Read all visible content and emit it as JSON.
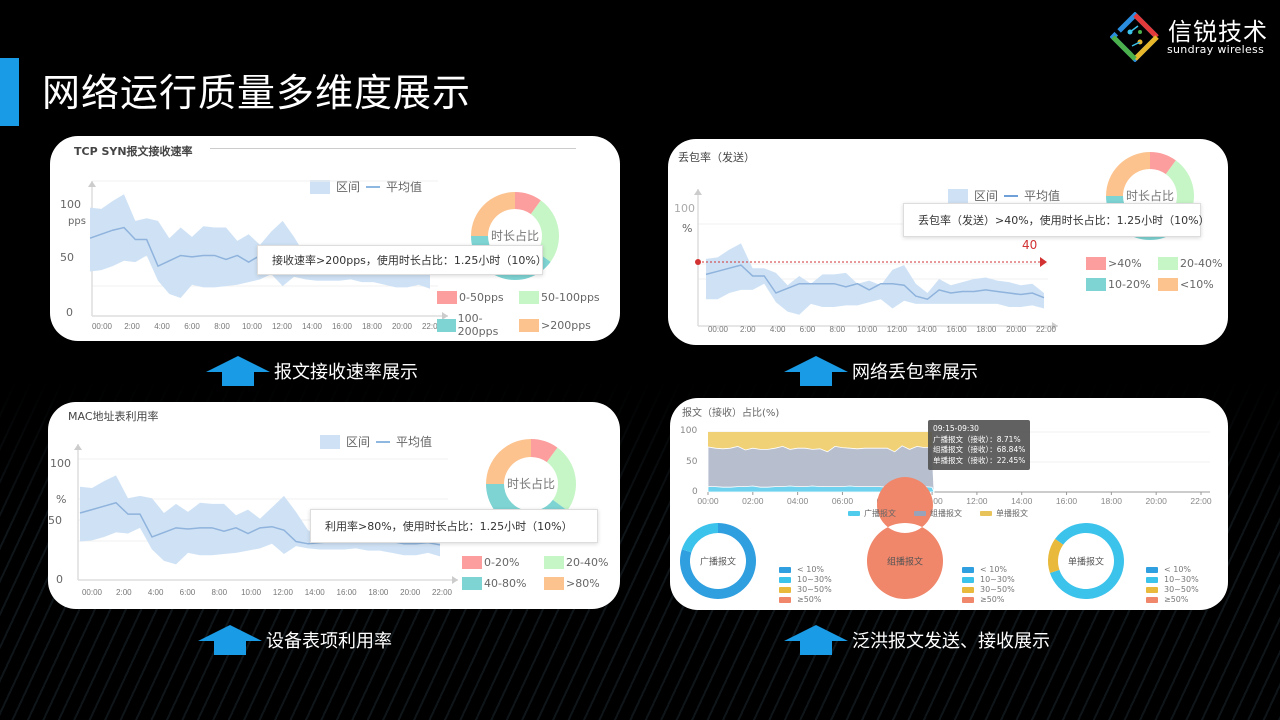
{
  "slide": {
    "title": "网络运行质量多维度展示",
    "accent_color": "#1a9be6"
  },
  "logo": {
    "name_cn": "信锐技术",
    "name_en": "sundray wireless"
  },
  "captions": [
    {
      "label": "报文接收速率展示",
      "icon": "arrow-up-icon"
    },
    {
      "label": "网络丢包率展示",
      "icon": "arrow-up-icon"
    },
    {
      "label": "设备表项利用率",
      "icon": "arrow-up-icon"
    },
    {
      "label": "泛洪报文发送、接收展示",
      "icon": "arrow-up-icon"
    }
  ],
  "chart_data": [
    {
      "type": "area",
      "title": "TCP SYN报文接收速率",
      "legend": [
        "区间",
        "平均值"
      ],
      "ylabel": "pps",
      "yticks": [
        "100",
        "50",
        "0"
      ],
      "ylim": [
        0,
        100
      ],
      "xticks": [
        "00:00",
        "2:00",
        "4:00",
        "6:00",
        "8:00",
        "10:00",
        "12:00",
        "14:00",
        "16:00",
        "18:00",
        "20:00",
        "22:00"
      ],
      "avg": [
        57,
        60,
        63,
        65,
        56,
        56,
        36,
        40,
        44,
        43,
        44,
        44,
        41,
        44,
        39,
        44,
        45,
        43,
        38,
        32,
        31,
        32,
        32,
        33,
        32,
        33,
        32,
        30,
        30,
        31,
        30
      ],
      "upper": [
        80,
        79,
        85,
        90,
        70,
        72,
        70,
        57,
        65,
        58,
        66,
        65,
        65,
        55,
        60,
        52,
        62,
        70,
        58,
        44,
        40,
        38,
        40,
        37,
        38,
        38,
        37,
        35,
        35,
        37,
        35
      ],
      "lower": [
        32,
        33,
        36,
        40,
        39,
        44,
        25,
        15,
        12,
        22,
        20,
        20,
        21,
        22,
        24,
        26,
        30,
        21,
        28,
        26,
        25,
        25,
        25,
        26,
        24,
        24,
        22,
        20,
        20,
        22,
        19
      ],
      "tooltip": "接收速率>200pps，使用时长占比：1.25小时（10%）",
      "donut": {
        "center_label": "时长占比",
        "slices": [
          {
            "label": "0-50pps",
            "value": 10,
            "color": "#fc9e9e"
          },
          {
            "label": "50-100pps",
            "value": 25,
            "color": "#c6f5c6"
          },
          {
            "label": "100-200pps",
            "value": 40,
            "color": "#7ed3d3"
          },
          {
            "label": ">200pps",
            "value": 25,
            "color": "#fcc38f"
          }
        ]
      }
    },
    {
      "type": "area",
      "title": "丢包率（发送）",
      "legend": [
        "区间",
        "平均值"
      ],
      "ylabel": "%",
      "yticks": [
        "100"
      ],
      "ylim": [
        0,
        100
      ],
      "threshold": {
        "value": 40,
        "label": "40",
        "color": "#d23232"
      },
      "xticks": [
        "00:00",
        "2:00",
        "4:00",
        "6:00",
        "8:00",
        "10:00",
        "12:00",
        "14:00",
        "16:00",
        "18:00",
        "20:00",
        "22:00"
      ],
      "avg": [
        32,
        34,
        36,
        38,
        31,
        31,
        20,
        23,
        26,
        26,
        26,
        26,
        24,
        26,
        22,
        26,
        26,
        25,
        18,
        16,
        22,
        20,
        21,
        21,
        22,
        21,
        20,
        19,
        20,
        17
      ],
      "upper": [
        42,
        43,
        48,
        52,
        36,
        36,
        33,
        25,
        31,
        26,
        32,
        32,
        33,
        26,
        28,
        25,
        35,
        38,
        26,
        20,
        29,
        25,
        27,
        29,
        30,
        28,
        27,
        25,
        26,
        20
      ],
      "lower": [
        16,
        16,
        20,
        22,
        22,
        26,
        14,
        8,
        6,
        13,
        11,
        11,
        12,
        12,
        14,
        16,
        10,
        15,
        13,
        13,
        13,
        13,
        13,
        13,
        13,
        13,
        11,
        11,
        12,
        10
      ],
      "tooltip": "丢包率（发送）>40%，使用时长占比：1.25小时（10%）",
      "donut": {
        "center_label": "时长占比",
        "slices": [
          {
            "label": ">40%",
            "value": 10,
            "color": "#fc9e9e"
          },
          {
            "label": "20-40%",
            "value": 25,
            "color": "#c6f5c6"
          },
          {
            "label": "10-20%",
            "value": 40,
            "color": "#7ed3d3"
          },
          {
            "label": "<10%",
            "value": 25,
            "color": "#fcc38f"
          }
        ]
      }
    },
    {
      "type": "area",
      "title": "MAC地址表利用率",
      "legend": [
        "区间",
        "平均值"
      ],
      "ylabel": "%",
      "yticks": [
        "100",
        "50",
        "0"
      ],
      "ylim": [
        0,
        100
      ],
      "xticks": [
        "00:00",
        "2:00",
        "4:00",
        "6:00",
        "8:00",
        "10:00",
        "12:00",
        "14:00",
        "16:00",
        "18:00",
        "20:00",
        "22:00"
      ],
      "avg": [
        57,
        60,
        63,
        66,
        56,
        56,
        36,
        40,
        44,
        43,
        44,
        44,
        41,
        44,
        39,
        44,
        45,
        42,
        32,
        30,
        31,
        32,
        32,
        33,
        32,
        33,
        32,
        30,
        30,
        31,
        29
      ],
      "upper": [
        80,
        79,
        85,
        90,
        70,
        72,
        70,
        57,
        65,
        58,
        66,
        65,
        65,
        55,
        60,
        52,
        62,
        72,
        58,
        42,
        36,
        38,
        40,
        37,
        38,
        38,
        37,
        35,
        35,
        37,
        33
      ],
      "lower": [
        32,
        33,
        36,
        40,
        39,
        44,
        25,
        15,
        12,
        22,
        20,
        20,
        21,
        22,
        24,
        26,
        30,
        21,
        28,
        26,
        25,
        25,
        25,
        26,
        24,
        24,
        22,
        20,
        20,
        22,
        19
      ],
      "tooltip": "利用率>80%，使用时长占比：1.25小时（10%）",
      "donut": {
        "center_label": "时长占比",
        "slices": [
          {
            "label": "0-20%",
            "value": 10,
            "color": "#fc9e9e"
          },
          {
            "label": "20-40%",
            "value": 25,
            "color": "#c6f5c6"
          },
          {
            "label": "40-80%",
            "value": 40,
            "color": "#7ed3d3"
          },
          {
            "label": ">80%",
            "value": 25,
            "color": "#fcc38f"
          }
        ]
      }
    },
    {
      "type": "area",
      "title": "报文（接收）占比(%)",
      "yticks": [
        "100",
        "50",
        "0"
      ],
      "ylim": [
        0,
        100
      ],
      "xticks": [
        "00:00",
        "02:00",
        "04:00",
        "06:00",
        "08:00",
        "10:00",
        "12:00",
        "14:00",
        "16:00",
        "18:00",
        "20:00",
        "22:00"
      ],
      "legend": [
        {
          "name": "广播报文",
          "color": "#4fcbeb"
        },
        {
          "name": "组播报文",
          "color": "#b7bfcf"
        },
        {
          "name": "单播报文",
          "color": "#f0d175"
        }
      ],
      "stacked_series_note": "data covers 00:00-10:00",
      "broadcast": [
        9,
        9,
        8,
        8,
        9,
        9,
        10,
        8,
        8,
        9,
        9,
        10,
        9,
        9,
        10,
        9,
        9,
        9,
        9,
        10,
        9,
        9,
        9,
        9,
        8,
        9,
        9,
        9,
        9,
        9,
        8
      ],
      "multicast_top": [
        75,
        73,
        72,
        73,
        76,
        70,
        73,
        71,
        71,
        73,
        76,
        71,
        73,
        73,
        71,
        72,
        67,
        76,
        74,
        73,
        72,
        73,
        73,
        73,
        73,
        67,
        77,
        71,
        76,
        74,
        75
      ],
      "tooltip": {
        "time": "09:15-09:30",
        "rows": [
          "广播报文（接收）：8.71%",
          "组播报文（接收）：68.84%",
          "单播报文（接收）：22.45%"
        ]
      },
      "donuts": [
        {
          "label": "广播报文",
          "slices": [
            {
              "name": "< 10%",
              "value": 80,
              "color": "#2f9fe0"
            },
            {
              "name": "10~30%",
              "value": 20,
              "color": "#3cc3ec"
            }
          ]
        },
        {
          "label": "组播报文",
          "slices": [
            {
              "name": "≥50%",
              "value": 100,
              "color": "#f0866a"
            }
          ]
        },
        {
          "label": "单播报文",
          "slices": [
            {
              "name": "10~30%",
              "value": 85,
              "color": "#3cc3ec"
            },
            {
              "name": "30~50%",
              "value": 15,
              "color": "#e8b93a"
            }
          ]
        }
      ],
      "mini_legend": [
        {
          "name": "< 10%",
          "color": "#2f9fe0"
        },
        {
          "name": "10~30%",
          "color": "#3cc3ec"
        },
        {
          "name": "30~50%",
          "color": "#e8b93a"
        },
        {
          "name": "≥50%",
          "color": "#f0866a"
        }
      ]
    }
  ]
}
